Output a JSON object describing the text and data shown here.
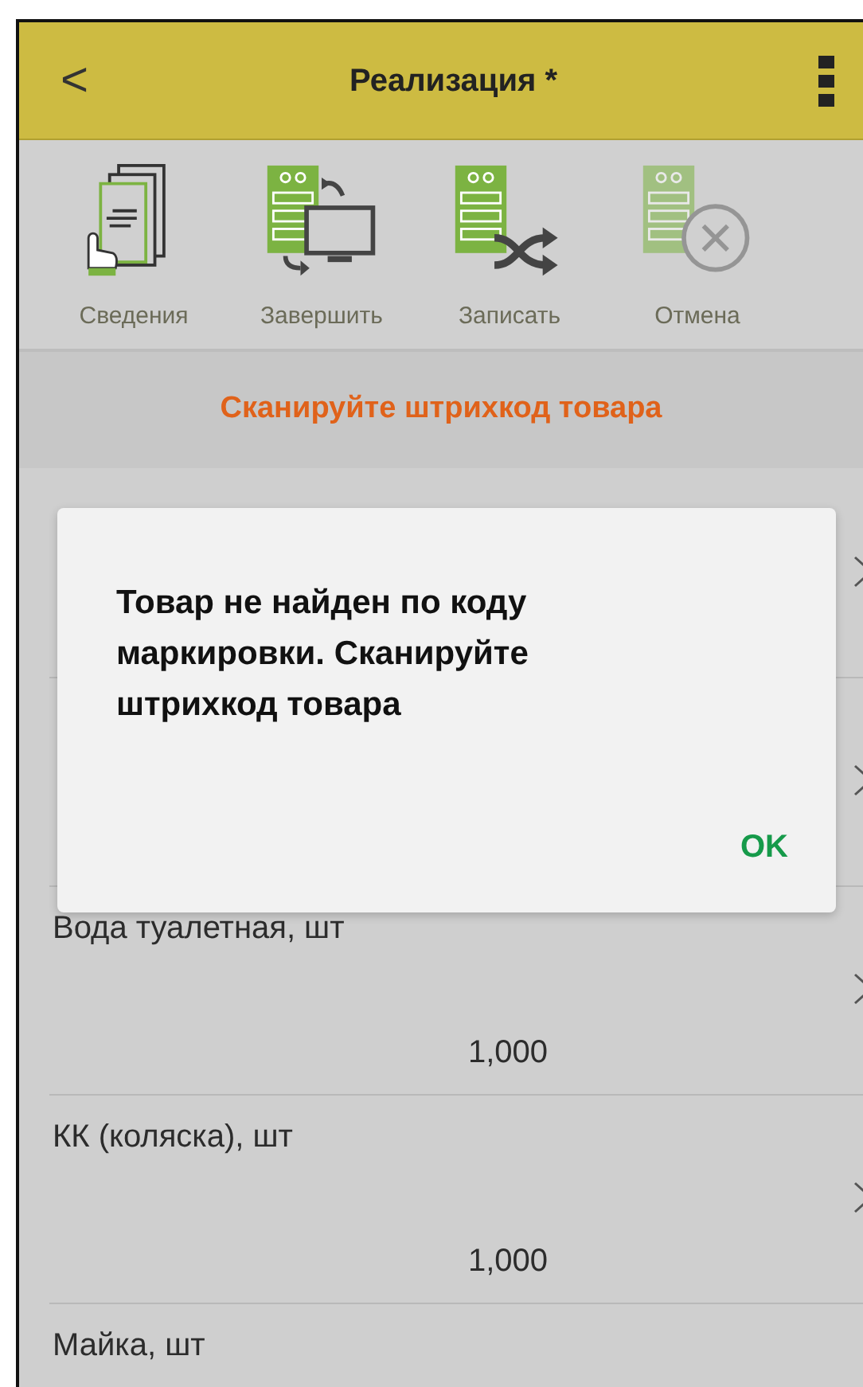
{
  "header": {
    "back": "<",
    "title": "Реализация *"
  },
  "toolbar": [
    {
      "kind": "info",
      "label": "Сведения",
      "disabled": false
    },
    {
      "kind": "finish",
      "label": "Завершить",
      "disabled": false
    },
    {
      "kind": "save",
      "label": "Записать",
      "disabled": false
    },
    {
      "kind": "cancel",
      "label": "Отмена",
      "disabled": true
    }
  ],
  "banner": "Сканируйте штрихкод товара",
  "rows": [
    {
      "chevron": true
    },
    {
      "chevron": true
    },
    {
      "name": "Вода туалетная, шт",
      "quantity": "1,000",
      "chevron": true
    },
    {
      "name": "КК (коляска), шт",
      "quantity": "1,000",
      "chevron": true
    },
    {
      "name": "Майка, шт",
      "chevron": false
    }
  ],
  "dialog": {
    "message": "Товар не найден по коду маркировки. Сканируйте штрихкод товара",
    "button": "OK"
  }
}
